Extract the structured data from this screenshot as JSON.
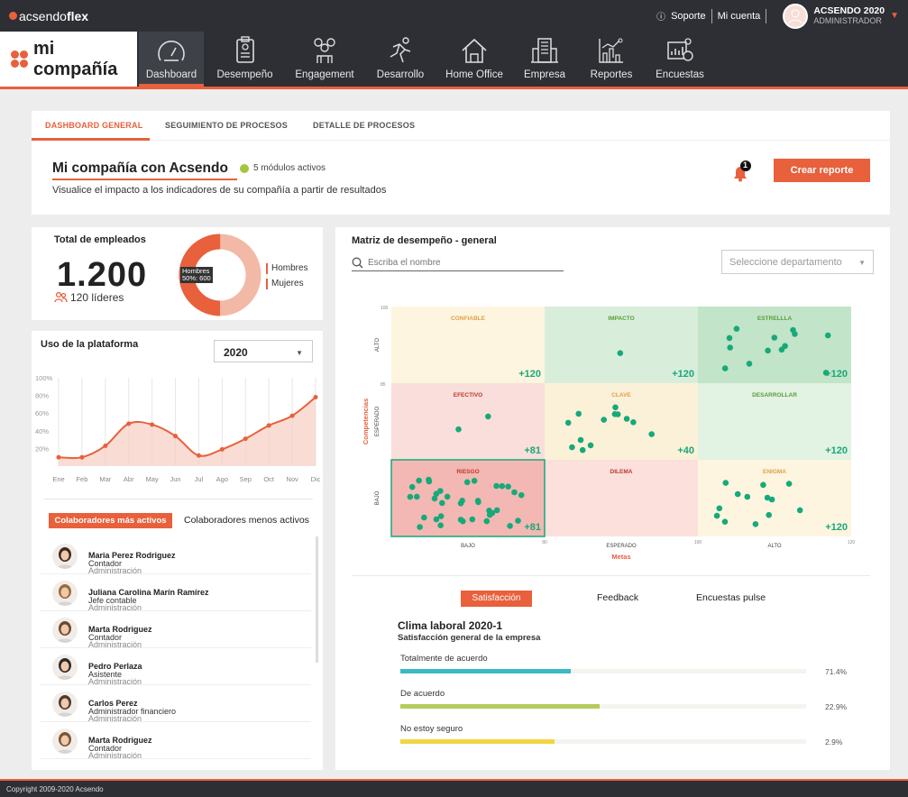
{
  "topbar": {
    "brand_prefix": "acsendo",
    "brand_suffix": "flex",
    "support": "Soporte",
    "account": "Mi cuenta",
    "user_name": "ACSENDO 2020",
    "user_role": "ADMINISTRADOR"
  },
  "nav": {
    "brand": "mi compañía",
    "items": [
      {
        "label": "Dashboard",
        "icon": "gauge-icon"
      },
      {
        "label": "Desempeño",
        "icon": "clipboard-icon"
      },
      {
        "label": "Engagement",
        "icon": "people-icon"
      },
      {
        "label": "Desarrollo",
        "icon": "runner-icon"
      },
      {
        "label": "Home Office",
        "icon": "home-icon"
      },
      {
        "label": "Empresa",
        "icon": "building-icon"
      },
      {
        "label": "Reportes",
        "icon": "chart-icon"
      },
      {
        "label": "Encuestas",
        "icon": "survey-icon"
      }
    ]
  },
  "tabs": [
    "DASHBOARD GENERAL",
    "SEGUIMIENTO DE PROCESOS",
    "DETALLE DE PROCESOS"
  ],
  "header": {
    "title": "Mi compañía con Acsendo",
    "modules": "5 módulos activos",
    "subtitle": "Visualice el impacto a los indicadores de su compañía a partir de resultados",
    "notif_count": "1",
    "create_button": "Crear reporte"
  },
  "employees": {
    "title": "Total de empleados",
    "total": "1.200",
    "leaders": "120 líderes",
    "tooltip_line1": "Hombres",
    "tooltip_line2": "50%: 600",
    "legend": [
      "Hombres",
      "Mujeres"
    ],
    "men_pct": 50,
    "women_pct": 50,
    "colors": {
      "men": "#e8603c",
      "women": "#f2b9a6"
    }
  },
  "usage": {
    "title": "Uso de la plataforma",
    "year": "2020"
  },
  "chart_data": {
    "type": "area",
    "categories": [
      "Ene",
      "Feb",
      "Mar",
      "Abr",
      "May",
      "Jun",
      "Jul",
      "Ago",
      "Sep",
      "Oct",
      "Nov",
      "Dic"
    ],
    "values": [
      10,
      10,
      23,
      48,
      47,
      34,
      12,
      19,
      31,
      46,
      57,
      78
    ],
    "yticks": [
      "100%",
      "80%",
      "60%",
      "40%",
      "20%"
    ],
    "ylim": [
      0,
      100
    ],
    "color": "#e8603c"
  },
  "collaborators": {
    "active_tab": "Colaboradores más activos",
    "inactive_tab": "Colaboradores menos activos",
    "list": [
      {
        "name": "Maria Perez Rodriguez",
        "role": "Contador",
        "dept": "Administración"
      },
      {
        "name": "Juliana Carolina Marín Ramírez",
        "role": "Jefe contable",
        "dept": "Administración"
      },
      {
        "name": "Marta Rodriguez",
        "role": "Contador",
        "dept": "Administración"
      },
      {
        "name": "Pedro Perlaza",
        "role": "Asistente",
        "dept": "Administración"
      },
      {
        "name": "Carlos Perez",
        "role": "Administrador financiero",
        "dept": "Administración"
      },
      {
        "name": "Marta Rodriguez",
        "role": "Contador",
        "dept": "Administración"
      }
    ]
  },
  "matrix": {
    "title": "Matriz de desempeño - general",
    "search_placeholder": "Escriba el nombre",
    "department_placeholder": "Seleccione departamento",
    "y_title": "Competencias",
    "x_title": "Metas",
    "y_levels": [
      "ALTO",
      "ESPERADO",
      "BAJO"
    ],
    "x_levels": [
      "BAJO",
      "ESPERADO",
      "ALTO"
    ],
    "y_ticks": [
      "100",
      "85"
    ],
    "x_ticks": [
      "80",
      "100",
      "120"
    ],
    "cells": [
      {
        "label": "CONFIABLE",
        "value": "+120",
        "fill": "#fdf5df",
        "labelColor": "#e0a04a"
      },
      {
        "label": "IMPACTO",
        "value": "+120",
        "fill": "#d8eedb",
        "labelColor": "#5a9e3a"
      },
      {
        "label": "ESTRELLLA",
        "value": "+120",
        "fill": "#c2e4c8",
        "labelColor": "#5a9e3a"
      },
      {
        "label": "EFECTIVO",
        "value": "+81",
        "fill": "#f9dedb",
        "labelColor": "#c0392b"
      },
      {
        "label": "CLAVE",
        "value": "+40",
        "fill": "#fbf1d9",
        "labelColor": "#e0a04a"
      },
      {
        "label": "DESARROLLAR",
        "value": "+120",
        "fill": "#e2f2e3",
        "labelColor": "#5a9e3a"
      },
      {
        "label": "RIESGO",
        "value": "+81",
        "fill": "#f3b8b3",
        "labelColor": "#c0392b"
      },
      {
        "label": "DILEMA",
        "value": "",
        "fill": "#fbe0dc",
        "labelColor": "#c0392b"
      },
      {
        "label": "ENIGMA",
        "value": "+120",
        "fill": "#fdf5df",
        "labelColor": "#e0a04a"
      }
    ],
    "value_color": "#17a97a",
    "dot_color": "#17a97a"
  },
  "survey": {
    "tabs": [
      "Satisfacción",
      "Feedback",
      "Encuestas pulse"
    ],
    "title": "Clima laboral 2020-1",
    "subtitle": "Satisfacción general de la empresa",
    "items": [
      {
        "label": "Totalmente de acuerdo",
        "pct": "71.4%",
        "fill": 0.42,
        "color": "#3cb8c6"
      },
      {
        "label": "De acuerdo",
        "pct": "22.9%",
        "fill": 0.49,
        "color": "#b5cc5b"
      },
      {
        "label": "No estoy seguro",
        "pct": "2.9%",
        "fill": 0.38,
        "color": "#f2d544"
      }
    ]
  },
  "footer": "Copyright 2009-2020 Acsendo"
}
